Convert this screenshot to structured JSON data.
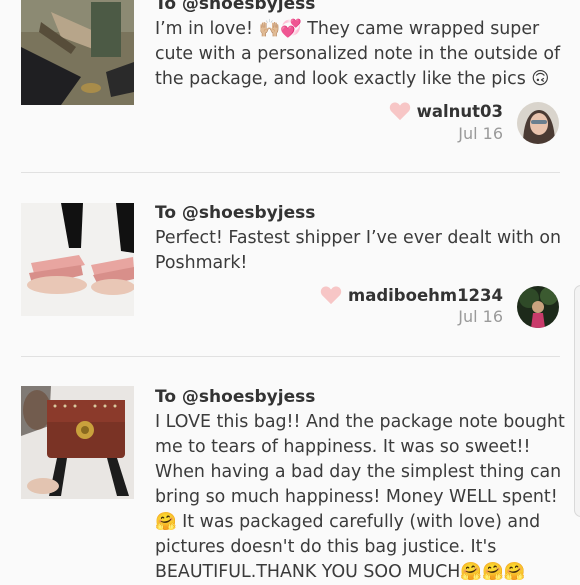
{
  "reviews": [
    {
      "to": "To @shoesbyjess",
      "lines": [
        "I’m in love! 🙌🏼💞 They came wrapped super",
        "cute with a personalized note in the outside of",
        "the package, and look exactly like the pics 🙃"
      ],
      "username": "walnut03",
      "date": "Jul 16"
    },
    {
      "to": "To @shoesbyjess",
      "lines": [
        "Perfect! Fastest shipper I’ve ever dealt with on",
        "Poshmark!"
      ],
      "username": "madiboehm1234",
      "date": "Jul 16"
    },
    {
      "to": "To @shoesbyjess",
      "lines": [
        "I LOVE this bag!! And the package note bought",
        "me to tears of happiness. It was so sweet!!",
        "When having a bad day the simplest thing can",
        "bring so much happiness! Money WELL spent!",
        "🤗 It was packaged carefully (with love) and",
        "pictures doesn't do this bag justice. It's",
        "BEAUTIFUL.THANK YOU SOO MUCH🤗🤗🤗"
      ]
    }
  ],
  "colors": {
    "heart": "#f7c6c6",
    "divider": "#e1e1e1",
    "date": "#9a9a9a"
  },
  "icons": {
    "like": "heart-icon"
  }
}
